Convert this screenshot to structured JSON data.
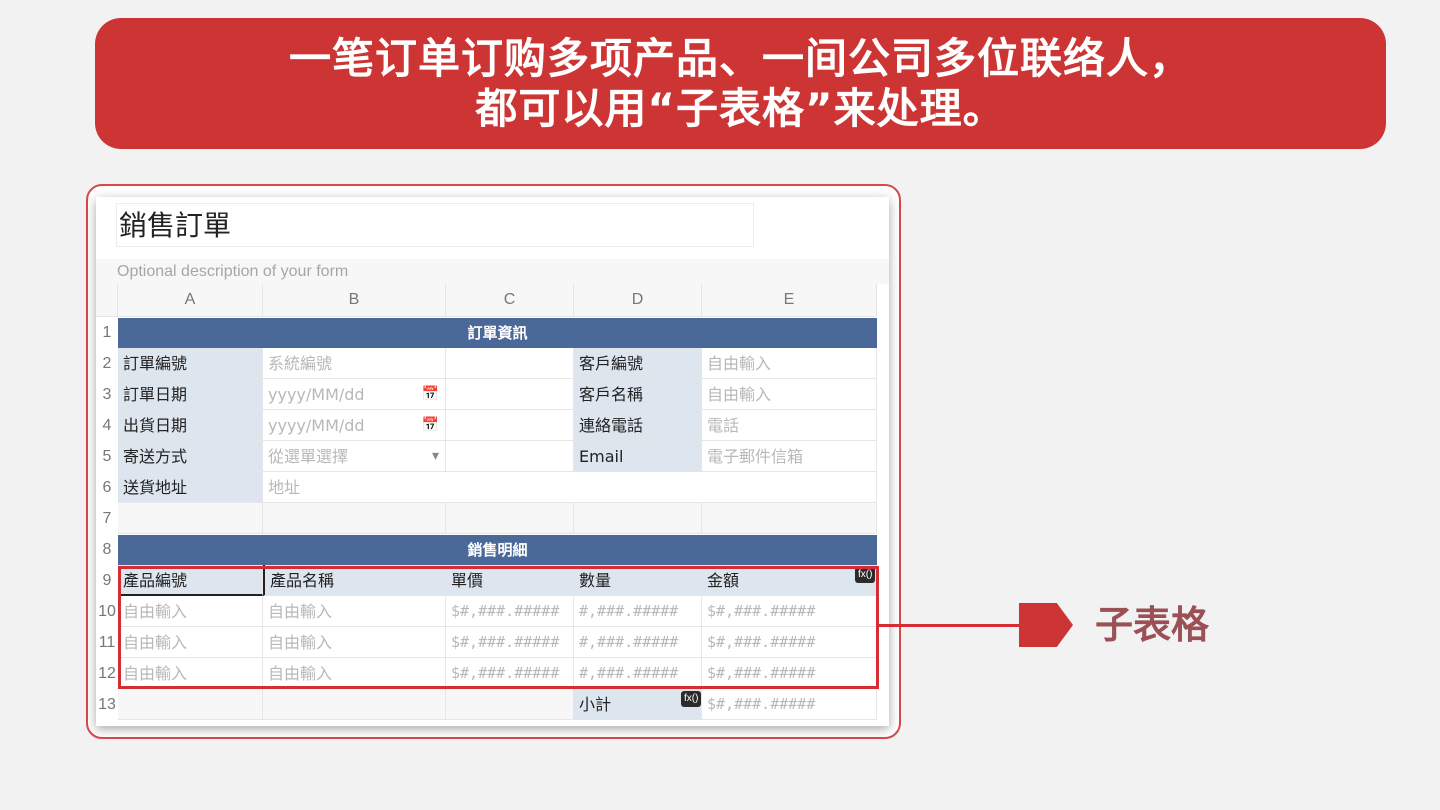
{
  "banner": {
    "line1": "一笔订单订购多项产品、一间公司多位联络人，",
    "line2": "都可以用“子表格”来处理。"
  },
  "form": {
    "title": "銷售訂單",
    "description": "Optional description of your form"
  },
  "columns": [
    "A",
    "B",
    "C",
    "D",
    "E"
  ],
  "rows": [
    "1",
    "2",
    "3",
    "4",
    "5",
    "6",
    "7",
    "8",
    "9",
    "10",
    "11",
    "12",
    "13"
  ],
  "section1": "訂單資訊",
  "order": {
    "order_no_label": "訂單編號",
    "order_no_ph": "系統編號",
    "order_date_label": "訂單日期",
    "order_date_ph": "yyyy/MM/dd",
    "ship_date_label": "出貨日期",
    "ship_date_ph": "yyyy/MM/dd",
    "ship_method_label": "寄送方式",
    "ship_method_ph": "從選單選擇",
    "address_label": "送貨地址",
    "address_ph": "地址",
    "cust_no_label": "客戶編號",
    "cust_no_ph": "自由輸入",
    "cust_name_label": "客戶名稱",
    "cust_name_ph": "自由輸入",
    "phone_label": "連絡電話",
    "phone_ph": "電話",
    "email_label": "Email",
    "email_ph": "電子郵件信箱"
  },
  "section2": "銷售明細",
  "detail": {
    "headers": [
      "產品編號",
      "產品名稱",
      "單價",
      "數量",
      "金額"
    ],
    "placeholders": [
      "自由輸入",
      "自由輸入",
      "$#,###.#####",
      "#,###.#####",
      "$#,###.#####"
    ],
    "fx": "fx()",
    "subtotal_label": "小計",
    "subtotal_ph": "$#,###.#####"
  },
  "callout": {
    "label": "子表格"
  },
  "colors": {
    "banner": "#cd3535",
    "band": "#4a6898",
    "label_bg": "#dde5ef",
    "highlight": "#d62c33"
  }
}
